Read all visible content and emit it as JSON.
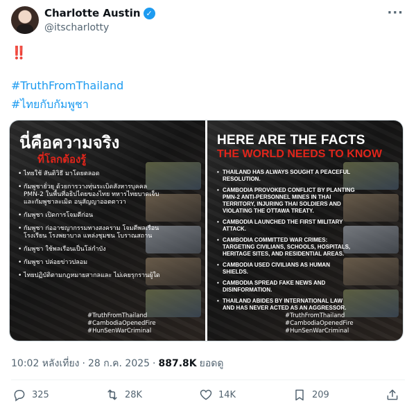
{
  "author": {
    "display_name": "Charlotte Austin",
    "handle": "@itscharlotty",
    "verified_icon": "verified-badge-icon"
  },
  "tweet": {
    "emoji": "‼️",
    "hashtags": [
      "#TruthFromThailand",
      "#ไทยกับกัมพูชา"
    ]
  },
  "images": {
    "left": {
      "title": "นี่คือความจริง",
      "subtitle": "ที่โลกต้องรู้",
      "bullets": [
        "ไทยใช้ สันติวิธี มาโดยตลอด",
        "กัมพูชายั่วยุ ด้วยการวางทุ่นระเบิดสังหารบุคคล PMN-2 ในพื้นที่อธิปไตยของไทย ทหารไทยบาดเจ็บ และกัมพูชาละเมิด อนุสัญญาออตตาวา",
        "กัมพูชา เปิดการโจมตีก่อน",
        "กัมพูชา ก่ออาชญากรรมทางสงคราม โจมตีพลเรือน โรงเรียน โรงพยาบาล แหล่งชุมชน โบราณสถาน",
        "กัมพูชา ใช้พลเรือนเป็นโล่กำบัง",
        "กัมพูชา ปล่อยข่าวปลอม",
        "ไทยปฏิบัติตามกฎหมายสากลและ ไม่เคยรุกรานผู้ใด"
      ],
      "tags": [
        "#TruthFromThailand",
        "#CambodiaOpenedFire",
        "#HunSenWarCriminal"
      ]
    },
    "right": {
      "title": "HERE ARE THE FACTS",
      "subtitle": "THE WORLD NEEDS TO KNOW",
      "bullets": [
        "THAILAND HAS ALWAYS SOUGHT A PEACEFUL RESOLUTION.",
        "CAMBODIA PROVOKED CONFLICT BY PLANTING PMN-2 ANTI-PERSONNEL MINES IN THAI TERRITORY, INJURING THAI SOLDIERS AND VIOLATING THE OTTAWA TREATY.",
        "CAMBODIA LAUNCHED THE FIRST MILITARY ATTACK.",
        "CAMBODIA COMMITTED WAR CRIMES: TARGETING CIVILIANS, SCHOOLS, HOSPITALS, HERITAGE SITES, AND RESIDENTIAL AREAS.",
        "CAMBODIA USED CIVILIANS AS HUMAN SHIELDS.",
        "CAMBODIA SPREAD FAKE NEWS AND DISINFORMATION.",
        "THAILAND ABIDES BY INTERNATIONAL LAW AND HAS NEVER ACTED AS AN AGGRESSOR."
      ],
      "tags": [
        "#TruthFromThailand",
        "#CambodiaOpenedFire",
        "#HunSenWarCriminal"
      ]
    }
  },
  "meta": {
    "time": "10:02 หลังเที่ยง",
    "sep1": "·",
    "date": "28 ก.ค. 2025",
    "sep2": "·",
    "views": "887.8K",
    "views_label": "ยอดดู"
  },
  "actions": {
    "replies": "325",
    "reposts": "28K",
    "likes": "14K",
    "bookmarks": "209"
  },
  "colors": {
    "accent": "#1d9bf0",
    "secondary_text": "#536471",
    "highlight_red": "#e0251b"
  }
}
